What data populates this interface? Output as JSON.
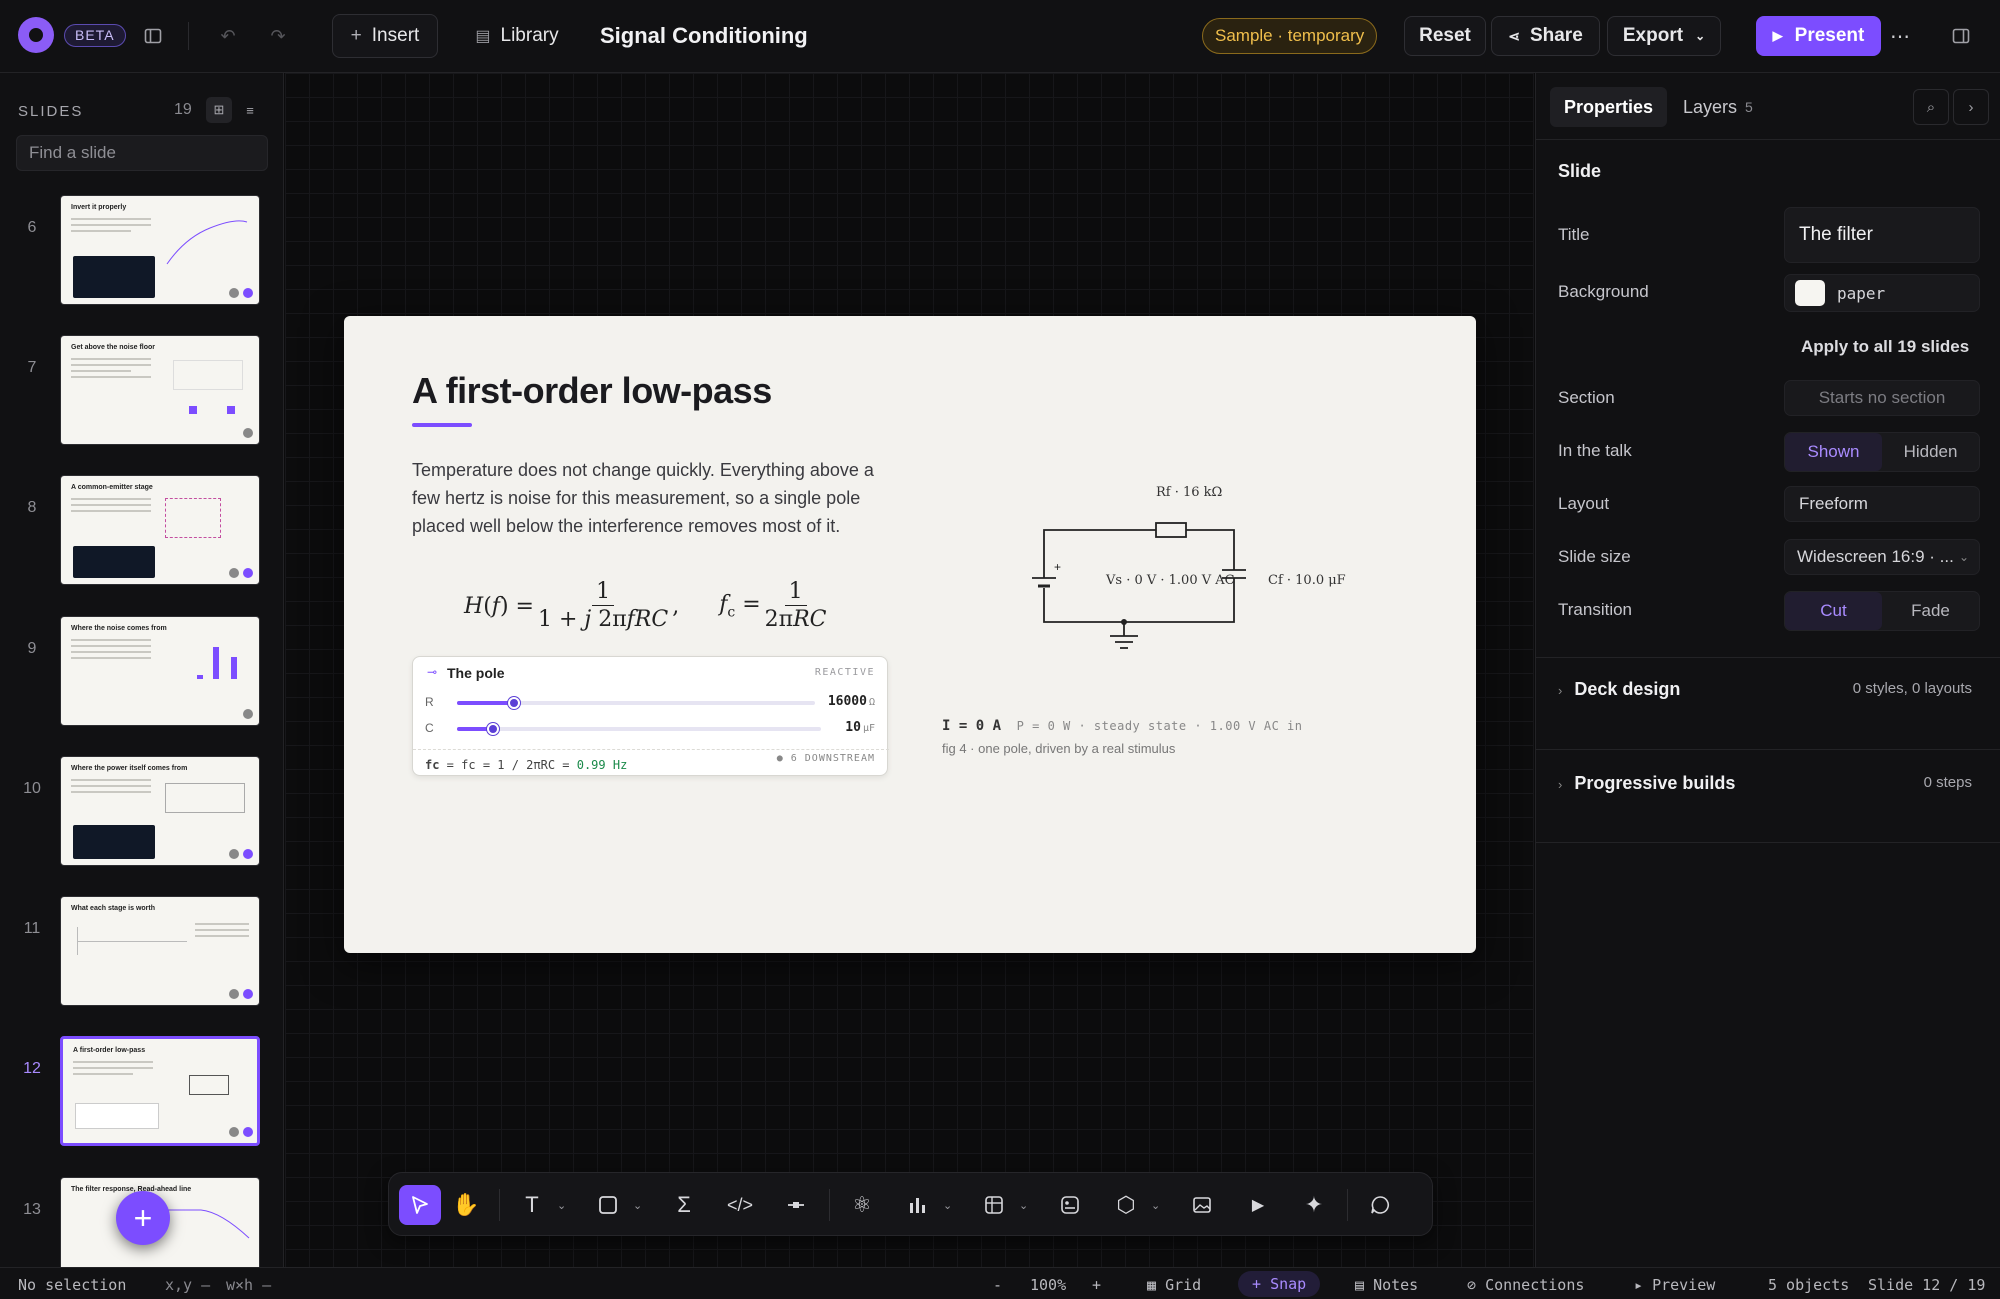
{
  "topbar": {
    "beta": "BETA",
    "insert": "Insert",
    "library": "Library",
    "doc_title": "Signal Conditioning",
    "sample_badge": "Sample · temporary",
    "reset": "Reset",
    "share": "Share",
    "export": "Export",
    "present": "Present"
  },
  "sidebar": {
    "heading": "SLIDES",
    "count": "19",
    "search_placeholder": "Find a slide",
    "slides": [
      {
        "num": "6",
        "title": "Invert it properly"
      },
      {
        "num": "7",
        "title": "Get above the noise floor"
      },
      {
        "num": "8",
        "title": "A common-emitter stage"
      },
      {
        "num": "9",
        "title": "Where the noise comes from"
      },
      {
        "num": "10",
        "title": "Where the power itself comes from"
      },
      {
        "num": "11",
        "title": "What each stage is worth"
      },
      {
        "num": "12",
        "title": "A first-order low-pass"
      },
      {
        "num": "13",
        "title": "The filter response, Read-ahead line"
      }
    ]
  },
  "slide": {
    "title": "A first-order low-pass",
    "body": "Temperature does not change quickly. Everything above a few hertz is noise for this measurement, so a single pole placed well below the interference removes most of it.",
    "widget": {
      "title": "The pole",
      "tag": "REACTIVE",
      "r_label": "R",
      "r_value": "16000",
      "r_unit": "Ω",
      "c_label": "C",
      "c_value": "10",
      "c_unit": "μF",
      "formula": "fc = 1 / 2πRC = ",
      "fc_value": "0.99 Hz",
      "downstream": "● 6 DOWNSTREAM"
    },
    "circuit": {
      "r_label": "Rf · 16 kΩ",
      "v_label": "Vs · 0 V · 1.00 V AC",
      "c_label": "Cf · 10.0 μF"
    },
    "readout_main": "I = 0 A",
    "readout_detail": "P = 0 W · steady state · 1.00 V AC in",
    "caption": "fig 4 · one pole, driven by a real stimulus"
  },
  "panel": {
    "tab_properties": "Properties",
    "tab_layers": "Layers",
    "layers_count": "5",
    "section_heading": "Slide",
    "title_label": "Title",
    "title_value": "The filter",
    "background_label": "Background",
    "background_value": "paper",
    "apply_all": "Apply to all 19 slides",
    "section_label": "Section",
    "section_value": "Starts no section",
    "talk_label": "In the talk",
    "talk_shown": "Shown",
    "talk_hidden": "Hidden",
    "layout_label": "Layout",
    "layout_value": "Freeform",
    "size_label": "Slide size",
    "size_value": "Widescreen 16:9 · ...",
    "transition_label": "Transition",
    "transition_cut": "Cut",
    "transition_fade": "Fade",
    "deck_design": "Deck design",
    "deck_design_meta": "0 styles, 0 layouts",
    "progressive": "Progressive builds",
    "progressive_meta": "0 steps"
  },
  "status": {
    "selection": "No selection",
    "xy": "x,y —",
    "wh": "w×h —",
    "zoom_out": "-",
    "zoom": "100%",
    "zoom_in": "+",
    "grid": "Grid",
    "snap": "Snap",
    "notes": "Notes",
    "connections": "Connections",
    "preview": "Preview",
    "objects": "5 objects",
    "slide_pos": "Slide 12 / 19"
  },
  "colors": {
    "accent": "#7c4dff",
    "sample_badge": "#f0bf4c",
    "fc_value": "#1a8a4a"
  },
  "widget_levels": {
    "r_fraction": 0.16,
    "c_fraction": 0.1
  }
}
